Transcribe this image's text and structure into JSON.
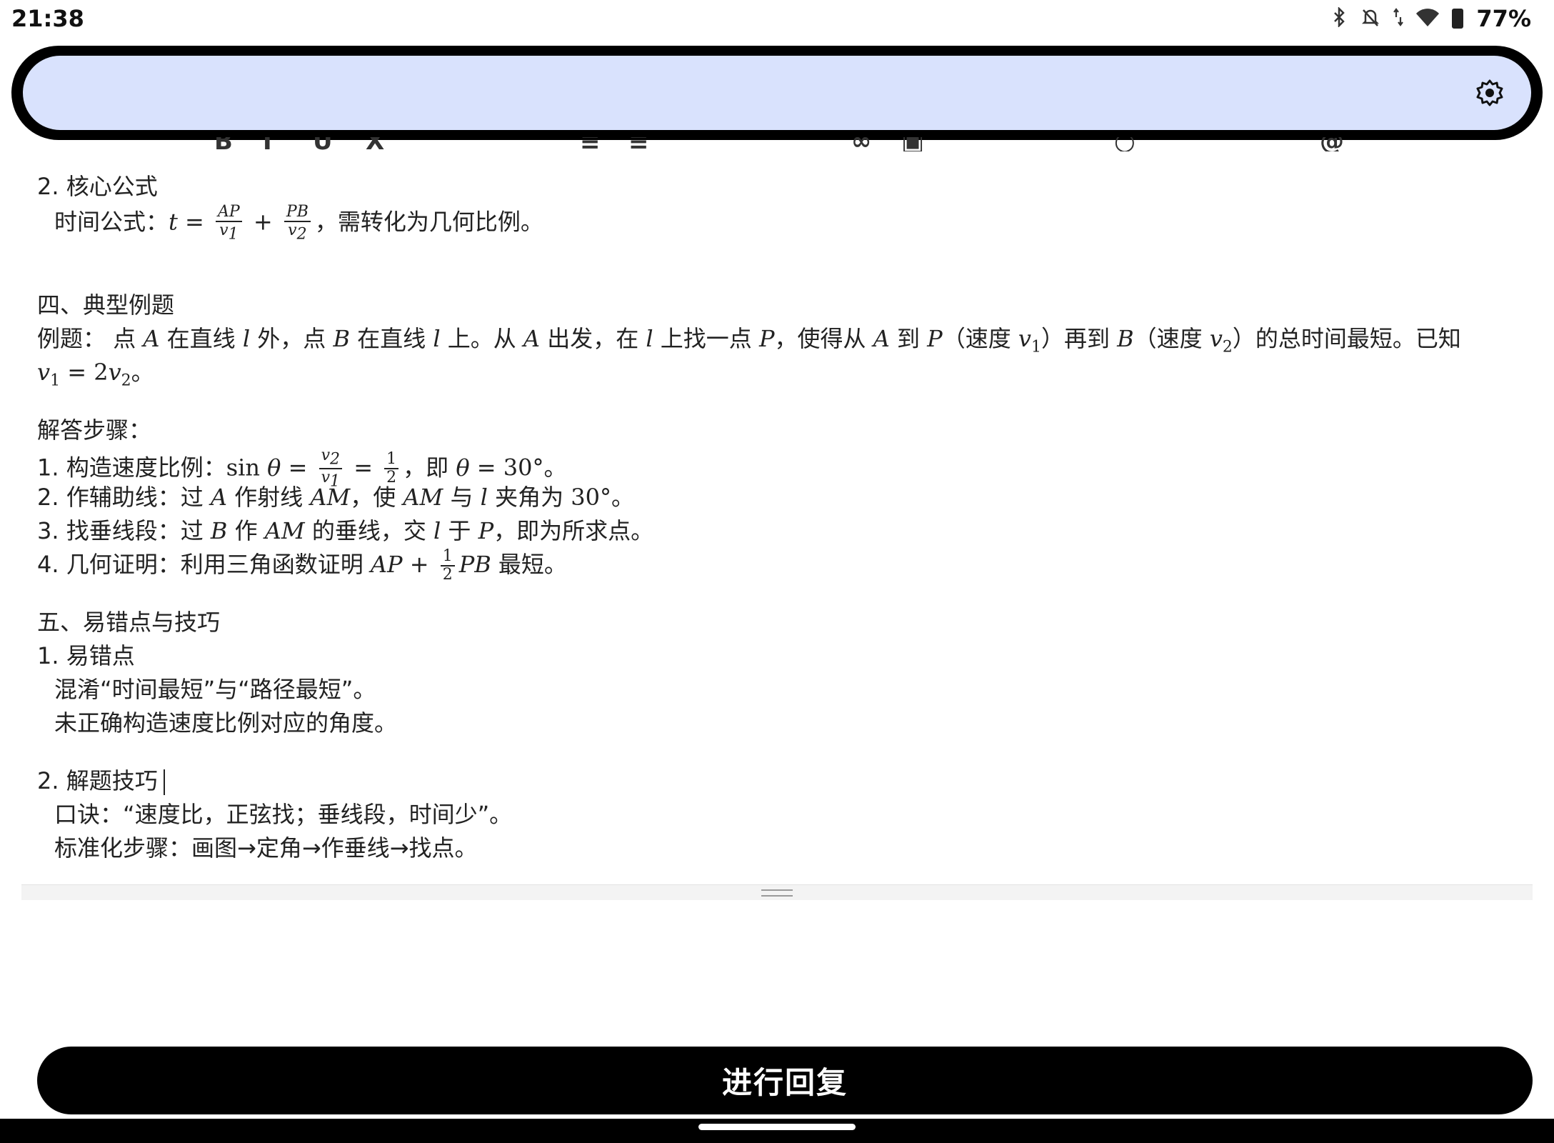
{
  "status_bar": {
    "time": "21:38",
    "battery": "77%",
    "icons": [
      "bluetooth-icon",
      "silent-icon",
      "data-arrows-icon",
      "wifi-icon",
      "battery-icon"
    ]
  },
  "top_bar": {
    "settings_icon": "settings-gear-icon",
    "color": "#d9e2fd"
  },
  "doc": {
    "formula_title": "2. 核心公式",
    "formula_prefix": "时间公式：",
    "formula_suffix": "，需转化为几何比例。",
    "example_heading": "四、典型例题",
    "example_label": "例题：",
    "solution_heading": "解答步骤：",
    "step1_prefix": "1. 构造速度比例：",
    "step2_prefix": "2. 作辅助线：过",
    "step3_prefix": "3. 找垂线段：过",
    "step4_prefix": "4. 几何证明：利用三角函数证明",
    "pitfall_heading": "五、易错点与技巧",
    "pitfall_title": "1. 易错点",
    "pitfall_1": "混淆“时间最短”与“路径最短”。",
    "pitfall_2": "未正确构造速度比例对应的角度。",
    "tips_title": "2. 解题技巧",
    "tips_1": "口诀：“速度比，正弦找；垂线段，时间少”。",
    "tips_2": "标准化步骤：画图→定角→作垂线→找点。"
  },
  "reply_button": {
    "label": "进行回复"
  }
}
